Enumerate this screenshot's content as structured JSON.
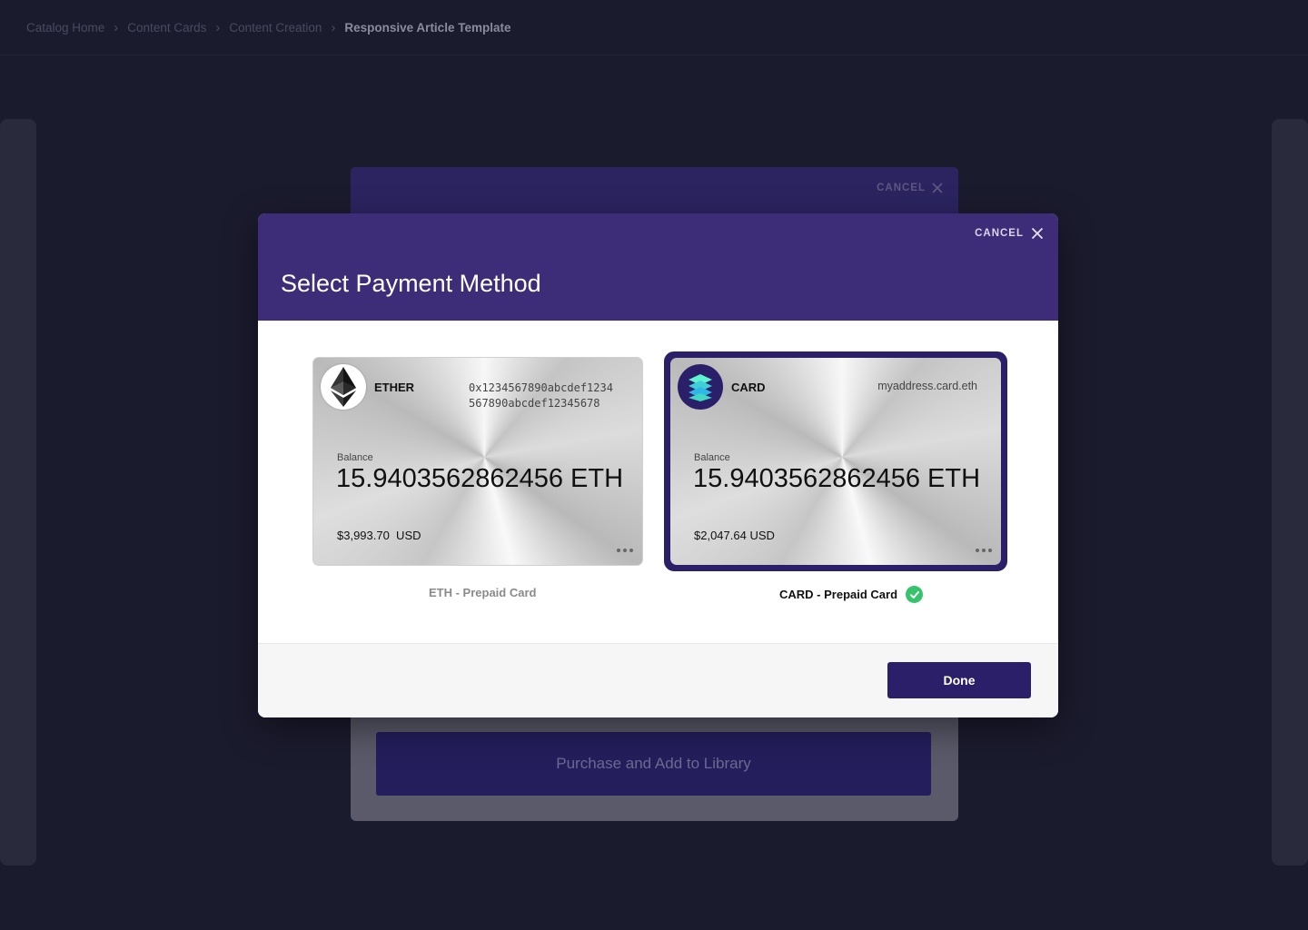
{
  "breadcrumb": {
    "items": [
      "Catalog Home",
      "Content Cards",
      "Content Creation"
    ],
    "current": "Responsive Article Template"
  },
  "background_dialog": {
    "cancel_label": "CANCEL",
    "purchase_label": "Purchase and Add to Library"
  },
  "modal": {
    "title": "Select Payment Method",
    "cancel_label": "CANCEL",
    "done_label": "Done"
  },
  "payment_methods": [
    {
      "name": "ETHER",
      "address": "0x1234567890abcdef1234567890abcdef12345678",
      "balance_label": "Balance",
      "balance": "15.9403562862456 ETH",
      "usd": "$3,993.70  USD",
      "caption": "ETH - Prepaid Card",
      "selected": false,
      "icon": "ethereum-logo-icon"
    },
    {
      "name": "CARD",
      "address": "myaddress.card.eth",
      "balance_label": "Balance",
      "balance": "15.9403562862456 ETH",
      "usd": "$2,047.64 USD",
      "caption": "CARD - Prepaid Card",
      "selected": true,
      "icon": "card-layers-logo-icon"
    }
  ],
  "colors": {
    "background": "#1b1b2e",
    "modal_header": "#3d2c78",
    "primary_button": "#2b1f6a",
    "selected_border": "#2b1f6a",
    "check_green": "#35c46c"
  }
}
